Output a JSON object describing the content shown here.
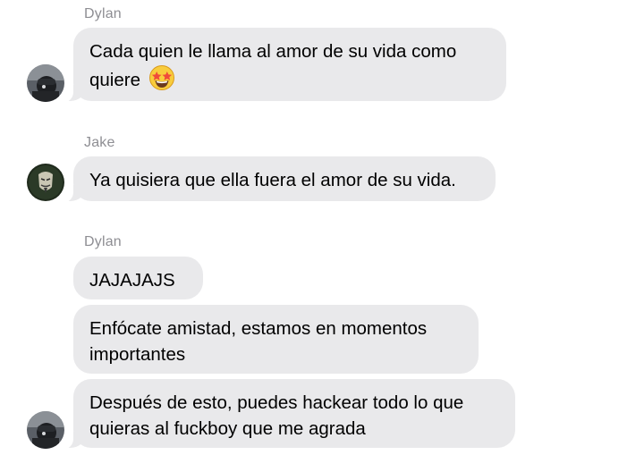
{
  "messages": [
    {
      "sender": "Dylan",
      "bubbles": [
        {
          "line1": "Cada quien le llama al amor de su vida como",
          "line2": "quiere",
          "emoji": "star-struck-emoji"
        }
      ]
    },
    {
      "sender": "Jake",
      "bubbles": [
        {
          "line1": "Ya quisiera que ella fuera el amor de su vida."
        }
      ]
    },
    {
      "sender": "Dylan",
      "bubbles": [
        {
          "line1": "JAJAJAJS"
        },
        {
          "line1": "Enfócate amistad, estamos en momentos",
          "line2": "importantes"
        },
        {
          "line1": "Después de esto, puedes hackear todo lo que",
          "line2": "quieras al fuckboy que me agrada"
        }
      ]
    }
  ],
  "colors": {
    "bubble_bg": "#e9e9eb",
    "sender_name": "#8e8e93",
    "text": "#000000"
  }
}
